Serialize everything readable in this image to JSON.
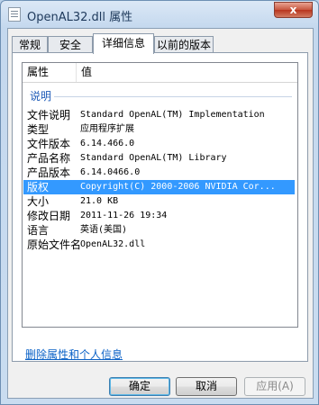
{
  "window": {
    "title": "OpenAL32.dll 属性",
    "close_label": "x"
  },
  "tabs": [
    {
      "label": "常规"
    },
    {
      "label": "安全"
    },
    {
      "label": "详细信息"
    },
    {
      "label": "以前的版本"
    }
  ],
  "list": {
    "header": {
      "property": "属性",
      "value": "值"
    },
    "group": "说明",
    "rows": [
      {
        "k": "文件说明",
        "v": "Standard OpenAL(TM) Implementation"
      },
      {
        "k": "类型",
        "v": "应用程序扩展"
      },
      {
        "k": "文件版本",
        "v": "6.14.466.0"
      },
      {
        "k": "产品名称",
        "v": "Standard OpenAL(TM) Library"
      },
      {
        "k": "产品版本",
        "v": "6.14.0466.0"
      },
      {
        "k": "版权",
        "v": "Copyright(C) 2000-2006 NVIDIA Cor..."
      },
      {
        "k": "大小",
        "v": "21.0 KB"
      },
      {
        "k": "修改日期",
        "v": "2011-11-26 19:34"
      },
      {
        "k": "语言",
        "v": "英语(美国)"
      },
      {
        "k": "原始文件名",
        "v": "OpenAL32.dll"
      }
    ]
  },
  "remove_link": "删除属性和个人信息",
  "buttons": {
    "ok": "确定",
    "cancel": "取消",
    "apply": "应用(A)"
  }
}
